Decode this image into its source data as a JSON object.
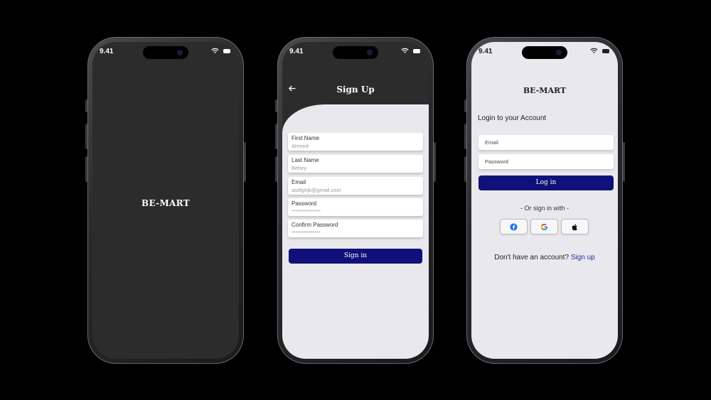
{
  "status_bar": {
    "time": "9.41"
  },
  "splash": {
    "brand": "BE-MART"
  },
  "signup": {
    "title": "Sign Up",
    "fields": [
      {
        "label": "First Name",
        "value": "Ahmed"
      },
      {
        "label": "Last Name",
        "value": "Behiry"
      },
      {
        "label": "Email",
        "value": "asdfghjk@gmail.com"
      },
      {
        "label": "Password",
        "value": "**************"
      },
      {
        "label": "Confirm Password",
        "value": "**************"
      }
    ],
    "submit_label": "Sign in"
  },
  "login": {
    "brand": "BE-MART",
    "heading": "Login to your Account",
    "email_placeholder": "Email",
    "password_placeholder": "Password",
    "submit_label": "Log in",
    "alt_text": "- Or sign in with -",
    "social": [
      "facebook-icon",
      "google-icon",
      "apple-icon"
    ],
    "no_account_text": "Don't have an account?",
    "signup_link": "Sign up"
  },
  "colors": {
    "primary": "#10107a",
    "dark_bg": "#2c2c2c",
    "light_bg": "#e9e9ed",
    "facebook": "#1877f2"
  }
}
